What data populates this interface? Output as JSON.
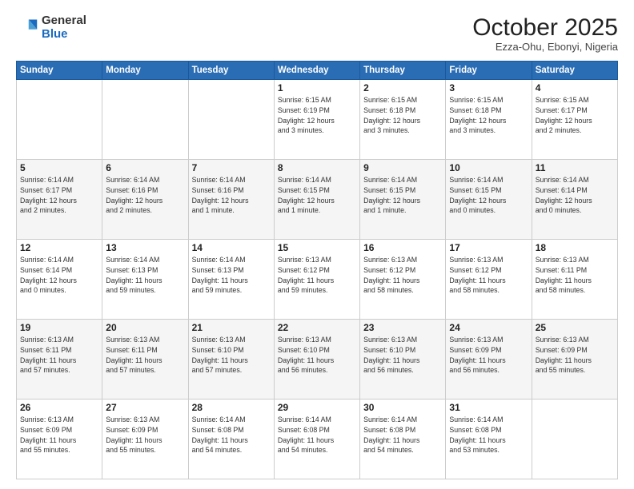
{
  "header": {
    "logo_general": "General",
    "logo_blue": "Blue",
    "month": "October 2025",
    "location": "Ezza-Ohu, Ebonyi, Nigeria"
  },
  "weekdays": [
    "Sunday",
    "Monday",
    "Tuesday",
    "Wednesday",
    "Thursday",
    "Friday",
    "Saturday"
  ],
  "weeks": [
    [
      {
        "day": "",
        "info": ""
      },
      {
        "day": "",
        "info": ""
      },
      {
        "day": "",
        "info": ""
      },
      {
        "day": "1",
        "info": "Sunrise: 6:15 AM\nSunset: 6:19 PM\nDaylight: 12 hours\nand 3 minutes."
      },
      {
        "day": "2",
        "info": "Sunrise: 6:15 AM\nSunset: 6:18 PM\nDaylight: 12 hours\nand 3 minutes."
      },
      {
        "day": "3",
        "info": "Sunrise: 6:15 AM\nSunset: 6:18 PM\nDaylight: 12 hours\nand 3 minutes."
      },
      {
        "day": "4",
        "info": "Sunrise: 6:15 AM\nSunset: 6:17 PM\nDaylight: 12 hours\nand 2 minutes."
      }
    ],
    [
      {
        "day": "5",
        "info": "Sunrise: 6:14 AM\nSunset: 6:17 PM\nDaylight: 12 hours\nand 2 minutes."
      },
      {
        "day": "6",
        "info": "Sunrise: 6:14 AM\nSunset: 6:16 PM\nDaylight: 12 hours\nand 2 minutes."
      },
      {
        "day": "7",
        "info": "Sunrise: 6:14 AM\nSunset: 6:16 PM\nDaylight: 12 hours\nand 1 minute."
      },
      {
        "day": "8",
        "info": "Sunrise: 6:14 AM\nSunset: 6:15 PM\nDaylight: 12 hours\nand 1 minute."
      },
      {
        "day": "9",
        "info": "Sunrise: 6:14 AM\nSunset: 6:15 PM\nDaylight: 12 hours\nand 1 minute."
      },
      {
        "day": "10",
        "info": "Sunrise: 6:14 AM\nSunset: 6:15 PM\nDaylight: 12 hours\nand 0 minutes."
      },
      {
        "day": "11",
        "info": "Sunrise: 6:14 AM\nSunset: 6:14 PM\nDaylight: 12 hours\nand 0 minutes."
      }
    ],
    [
      {
        "day": "12",
        "info": "Sunrise: 6:14 AM\nSunset: 6:14 PM\nDaylight: 12 hours\nand 0 minutes."
      },
      {
        "day": "13",
        "info": "Sunrise: 6:14 AM\nSunset: 6:13 PM\nDaylight: 11 hours\nand 59 minutes."
      },
      {
        "day": "14",
        "info": "Sunrise: 6:14 AM\nSunset: 6:13 PM\nDaylight: 11 hours\nand 59 minutes."
      },
      {
        "day": "15",
        "info": "Sunrise: 6:13 AM\nSunset: 6:12 PM\nDaylight: 11 hours\nand 59 minutes."
      },
      {
        "day": "16",
        "info": "Sunrise: 6:13 AM\nSunset: 6:12 PM\nDaylight: 11 hours\nand 58 minutes."
      },
      {
        "day": "17",
        "info": "Sunrise: 6:13 AM\nSunset: 6:12 PM\nDaylight: 11 hours\nand 58 minutes."
      },
      {
        "day": "18",
        "info": "Sunrise: 6:13 AM\nSunset: 6:11 PM\nDaylight: 11 hours\nand 58 minutes."
      }
    ],
    [
      {
        "day": "19",
        "info": "Sunrise: 6:13 AM\nSunset: 6:11 PM\nDaylight: 11 hours\nand 57 minutes."
      },
      {
        "day": "20",
        "info": "Sunrise: 6:13 AM\nSunset: 6:11 PM\nDaylight: 11 hours\nand 57 minutes."
      },
      {
        "day": "21",
        "info": "Sunrise: 6:13 AM\nSunset: 6:10 PM\nDaylight: 11 hours\nand 57 minutes."
      },
      {
        "day": "22",
        "info": "Sunrise: 6:13 AM\nSunset: 6:10 PM\nDaylight: 11 hours\nand 56 minutes."
      },
      {
        "day": "23",
        "info": "Sunrise: 6:13 AM\nSunset: 6:10 PM\nDaylight: 11 hours\nand 56 minutes."
      },
      {
        "day": "24",
        "info": "Sunrise: 6:13 AM\nSunset: 6:09 PM\nDaylight: 11 hours\nand 56 minutes."
      },
      {
        "day": "25",
        "info": "Sunrise: 6:13 AM\nSunset: 6:09 PM\nDaylight: 11 hours\nand 55 minutes."
      }
    ],
    [
      {
        "day": "26",
        "info": "Sunrise: 6:13 AM\nSunset: 6:09 PM\nDaylight: 11 hours\nand 55 minutes."
      },
      {
        "day": "27",
        "info": "Sunrise: 6:13 AM\nSunset: 6:09 PM\nDaylight: 11 hours\nand 55 minutes."
      },
      {
        "day": "28",
        "info": "Sunrise: 6:14 AM\nSunset: 6:08 PM\nDaylight: 11 hours\nand 54 minutes."
      },
      {
        "day": "29",
        "info": "Sunrise: 6:14 AM\nSunset: 6:08 PM\nDaylight: 11 hours\nand 54 minutes."
      },
      {
        "day": "30",
        "info": "Sunrise: 6:14 AM\nSunset: 6:08 PM\nDaylight: 11 hours\nand 54 minutes."
      },
      {
        "day": "31",
        "info": "Sunrise: 6:14 AM\nSunset: 6:08 PM\nDaylight: 11 hours\nand 53 minutes."
      },
      {
        "day": "",
        "info": ""
      }
    ]
  ]
}
